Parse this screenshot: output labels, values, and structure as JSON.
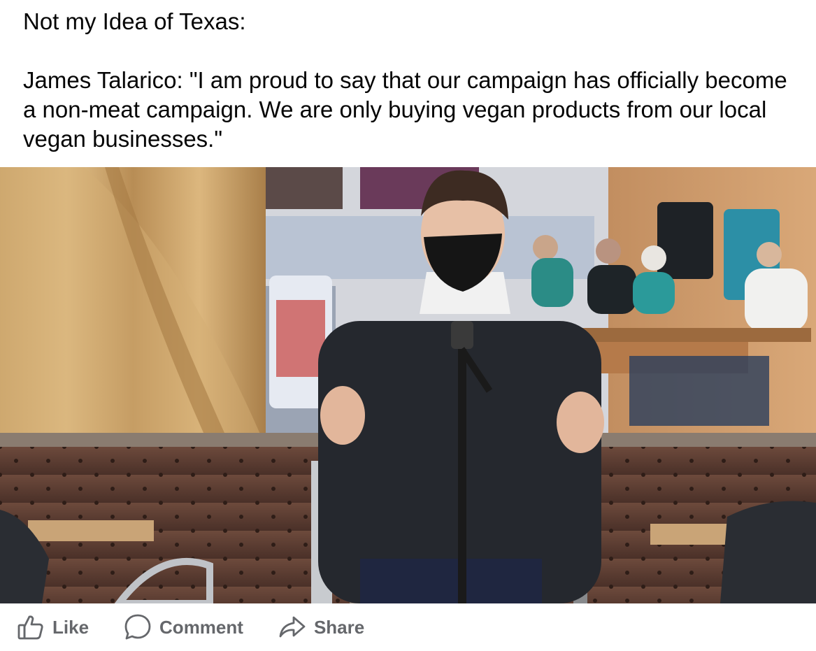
{
  "post": {
    "line1": "Not my Idea of Texas:",
    "line2": "James Talarico: \"I am proud to say that our campaign has officially become a non-meat campaign. We are only buying vegan products from our local vegan businesses.\""
  },
  "photo": {
    "description": "man in black face mask speaking at microphone in restaurant"
  },
  "actions": {
    "like": "Like",
    "comment": "Comment",
    "share": "Share"
  },
  "colors": {
    "action_text": "#65676b",
    "post_text": "#050505"
  },
  "icons": [
    "thumbs-up-icon",
    "comment-bubble-icon",
    "share-arrow-icon"
  ]
}
